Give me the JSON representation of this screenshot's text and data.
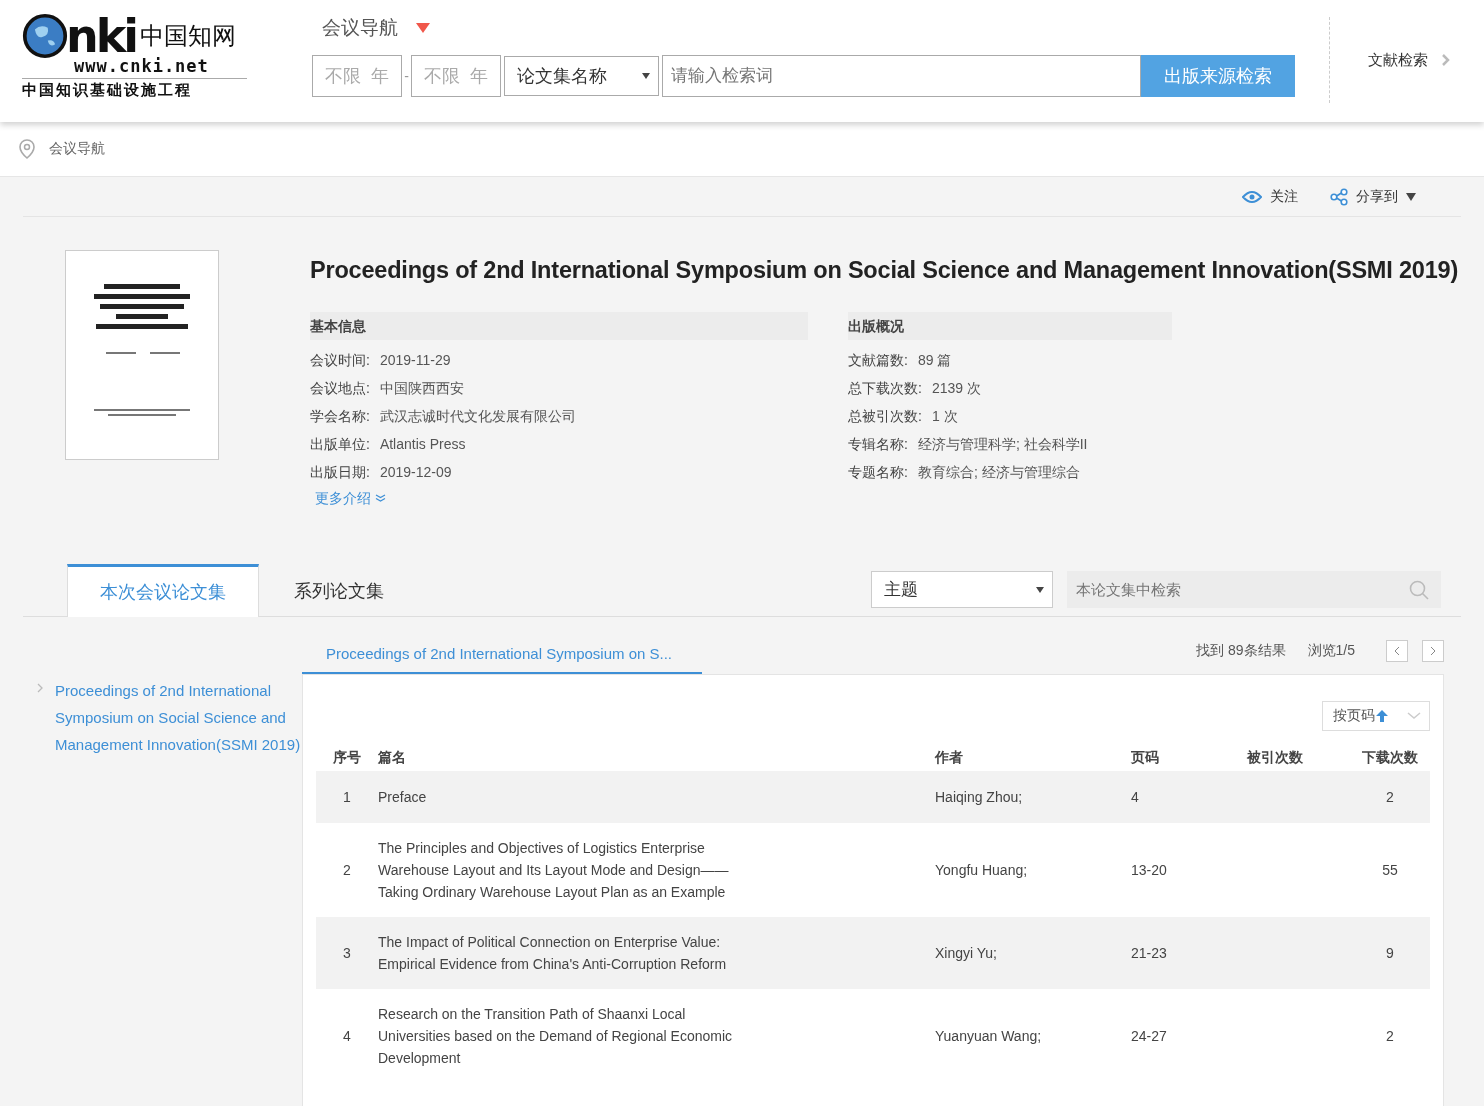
{
  "logo": {
    "mark": "nki",
    "name": "中国知网",
    "url": "www.cnki.net",
    "tagline": "中国知识基础设施工程"
  },
  "nav": {
    "label": "会议导航"
  },
  "search": {
    "year_from": "不限  年",
    "year_to": "不限  年",
    "dash": "-",
    "field": "论文集名称",
    "placeholder": "请输入检索词",
    "button": "出版来源检索"
  },
  "side_link": "文献检索",
  "breadcrumb": "会议导航",
  "actions": [
    {
      "kind": "follow",
      "label": "关注"
    },
    {
      "kind": "share",
      "label": "分享到"
    }
  ],
  "title": "Proceedings of 2nd International Symposium on Social Science and Management Innovation(SSMI 2019)",
  "sections": [
    {
      "heading": "基本信息",
      "fields": [
        {
          "label": "会议时间:",
          "value": "2019-11-29"
        },
        {
          "label": "会议地点:",
          "value": "中国陕西西安"
        },
        {
          "label": "学会名称:",
          "value": "武汉志诚时代文化发展有限公司"
        },
        {
          "label": "出版单位:",
          "value": "Atlantis Press"
        },
        {
          "label": "出版日期:",
          "value": "2019-12-09"
        }
      ],
      "more": "更多介绍"
    },
    {
      "heading": "出版概况",
      "fields": [
        {
          "label": "文献篇数:",
          "value": "89 篇"
        },
        {
          "label": "总下载次数:",
          "value": "2139 次"
        },
        {
          "label": "总被引次数:",
          "value": "1 次"
        },
        {
          "label": "专辑名称:",
          "value": "经济与管理科学; 社会科学II"
        },
        {
          "label": "专题名称:",
          "value": "教育综合; 经济与管理综合"
        }
      ]
    }
  ],
  "tabs": [
    {
      "label": "本次会议论文集",
      "selected": true
    },
    {
      "label": "系列论文集",
      "selected": false
    }
  ],
  "filter": {
    "field": "主题",
    "placeholder": "本论文集中检索"
  },
  "tree": [
    {
      "label": "Proceedings of 2nd International Symposium on Social Science and Management Innovation(SSMI 2019)"
    }
  ],
  "subtab": "Proceedings of 2nd International Symposium on S...",
  "found": "找到 89条结果",
  "page": "浏览1/5",
  "sort": "按页码",
  "table": {
    "columns": [
      "序号",
      "篇名",
      "作者",
      "页码",
      "被引次数",
      "下载次数"
    ],
    "rows": [
      [
        "1",
        "Preface",
        "Haiqing Zhou;",
        "4",
        "",
        "2"
      ],
      [
        "2",
        "The Principles and Objectives of Logistics Enterprise Warehouse Layout and Its Layout Mode and Design——Taking Ordinary Warehouse Layout Plan as an Example",
        "Yongfu Huang;",
        "13-20",
        "",
        "55"
      ],
      [
        "3",
        "The Impact of Political Connection on Enterprise Value: Empirical Evidence from China's Anti-Corruption Reform",
        "Xingyi Yu;",
        "21-23",
        "",
        "9"
      ],
      [
        "4",
        "Research on the Transition Path of Shaanxi Local Universities based on the Demand of Regional Economic Development",
        "Yuanyuan Wang;",
        "24-27",
        "",
        "2"
      ]
    ]
  }
}
